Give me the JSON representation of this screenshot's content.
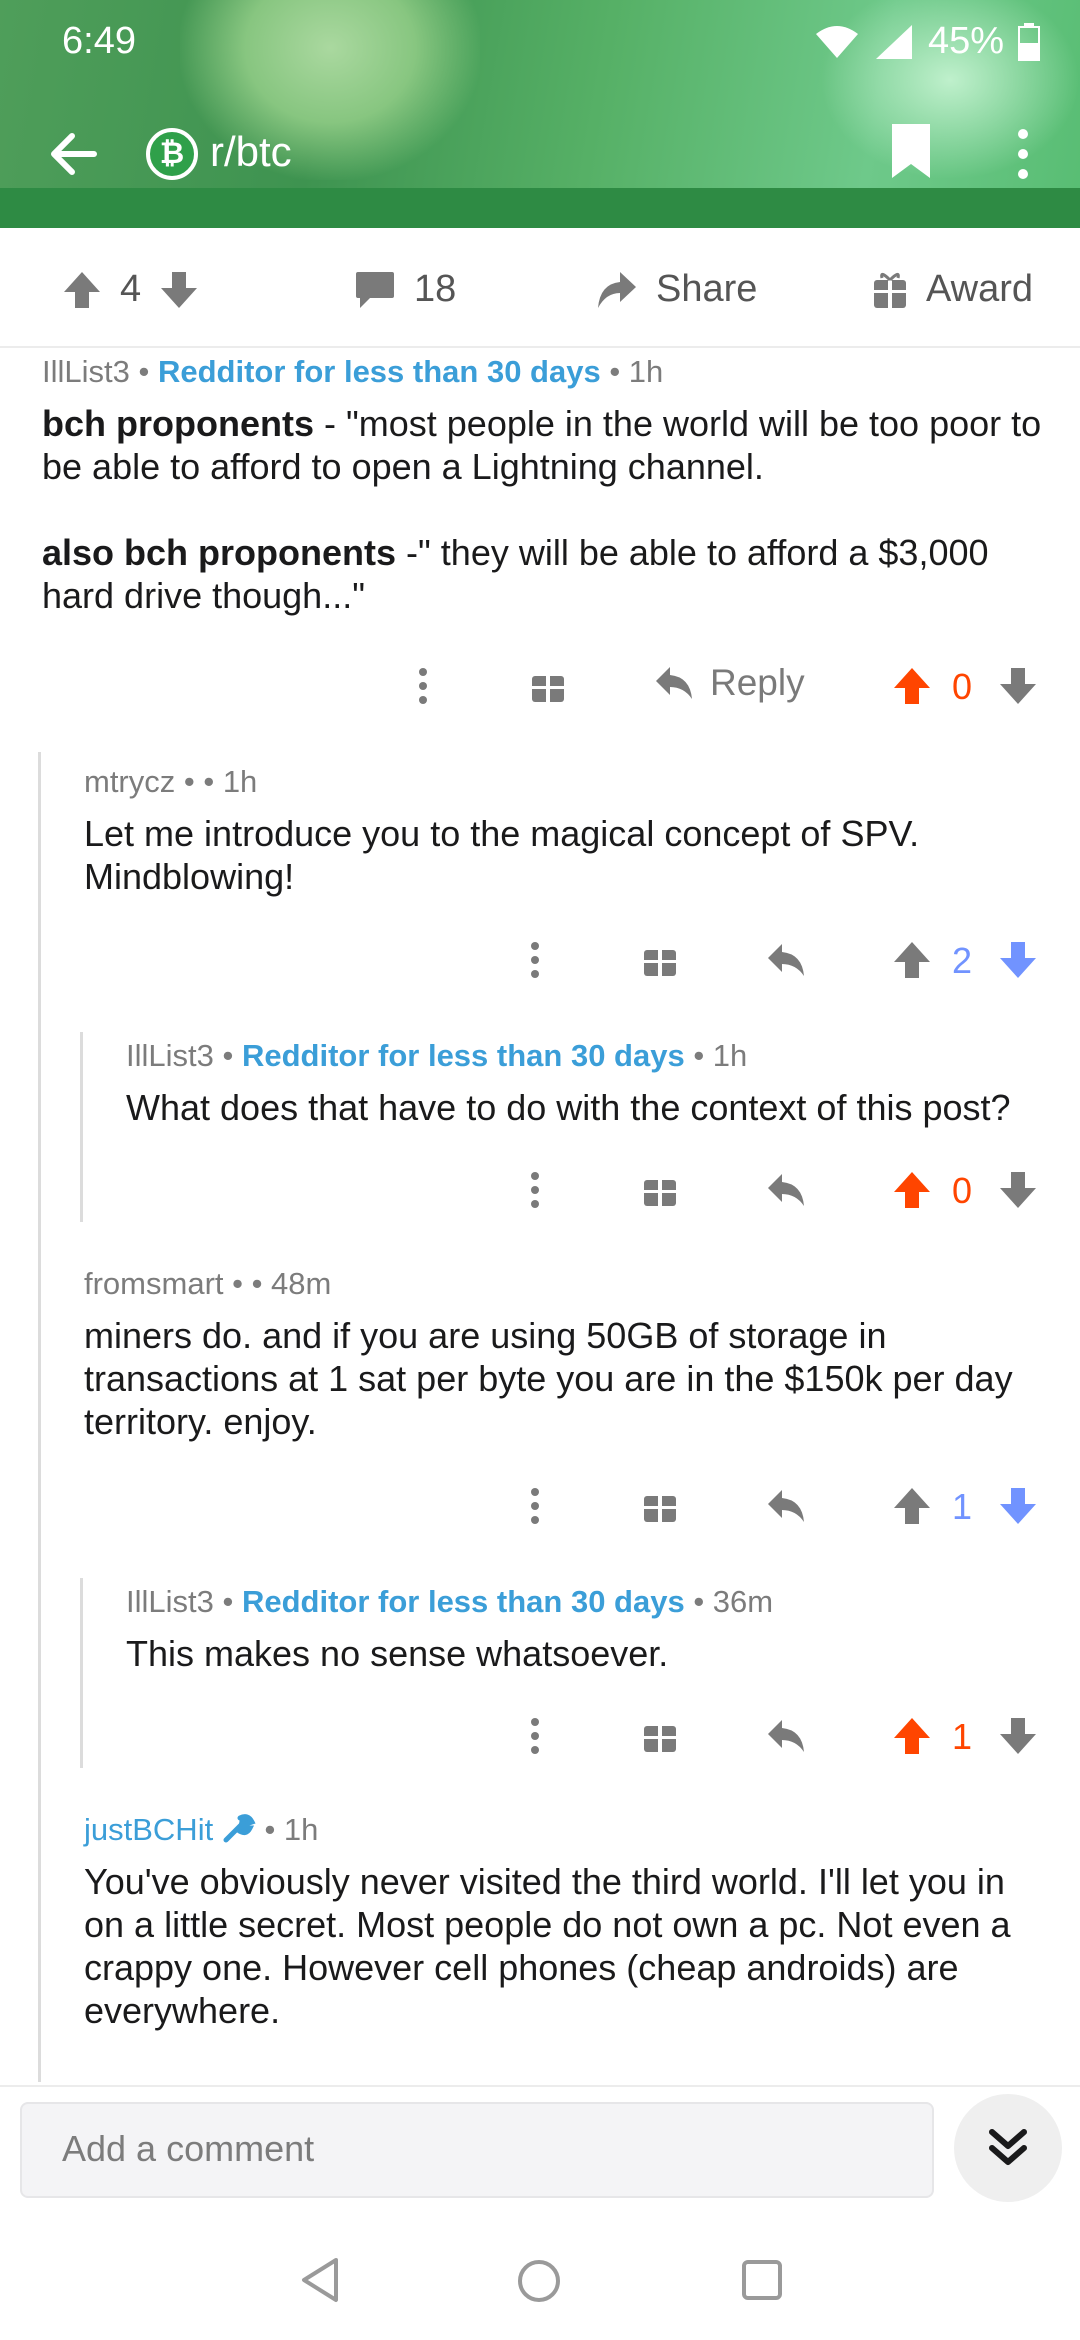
{
  "status": {
    "time": "6:49",
    "battery": "45%"
  },
  "toolbar": {
    "subreddit": "r/btc",
    "sub_icon_glyph": "₿"
  },
  "post_actions": {
    "score": "4",
    "comments": "18",
    "share": "Share",
    "award": "Award"
  },
  "comments": [
    {
      "user": "IllList3",
      "flair": "Redditor for less than 30 days",
      "age": "1h",
      "p1_bold": "bch proponents",
      "p1_text": " - \"most people in the world will be too poor to be able to afford to open a Lightning channel.",
      "p2_bold": "also bch proponents",
      "p2_text": " -\" they will be able to afford a $3,000 hard drive though...\"",
      "reply": "Reply",
      "score": "0"
    },
    {
      "user": "mtrycz",
      "age": "1h",
      "text": "Let me introduce you to the magical concept of SPV. Mindblowing!",
      "score": "2"
    },
    {
      "user": "IllList3",
      "flair": "Redditor for less than 30 days",
      "age": "1h",
      "text": "What does that have to do with the context of this post?",
      "score": "0"
    },
    {
      "user": "fromsmart",
      "age": "48m",
      "text": "miners do. and if you are using 50GB of storage in transactions at 1 sat per byte you are in the $150k per day territory. enjoy.",
      "score": "1"
    },
    {
      "user": "IllList3",
      "flair": "Redditor for less than 30 days",
      "age": "36m",
      "text": "This makes no sense whatsoever.",
      "score": "1"
    },
    {
      "user": "justBCHit",
      "age": "1h",
      "text": "You've obviously never visited the third world. I'll let you in on a little secret. Most people do not own a pc. Not even a crappy one. However cell phones (cheap androids) are everywhere."
    }
  ],
  "composer": {
    "placeholder": "Add a comment"
  },
  "colors": {
    "header": "#3e9350",
    "flair": "#3b9ed8",
    "upvote": "#ff4500",
    "downvote": "#7193ff"
  }
}
